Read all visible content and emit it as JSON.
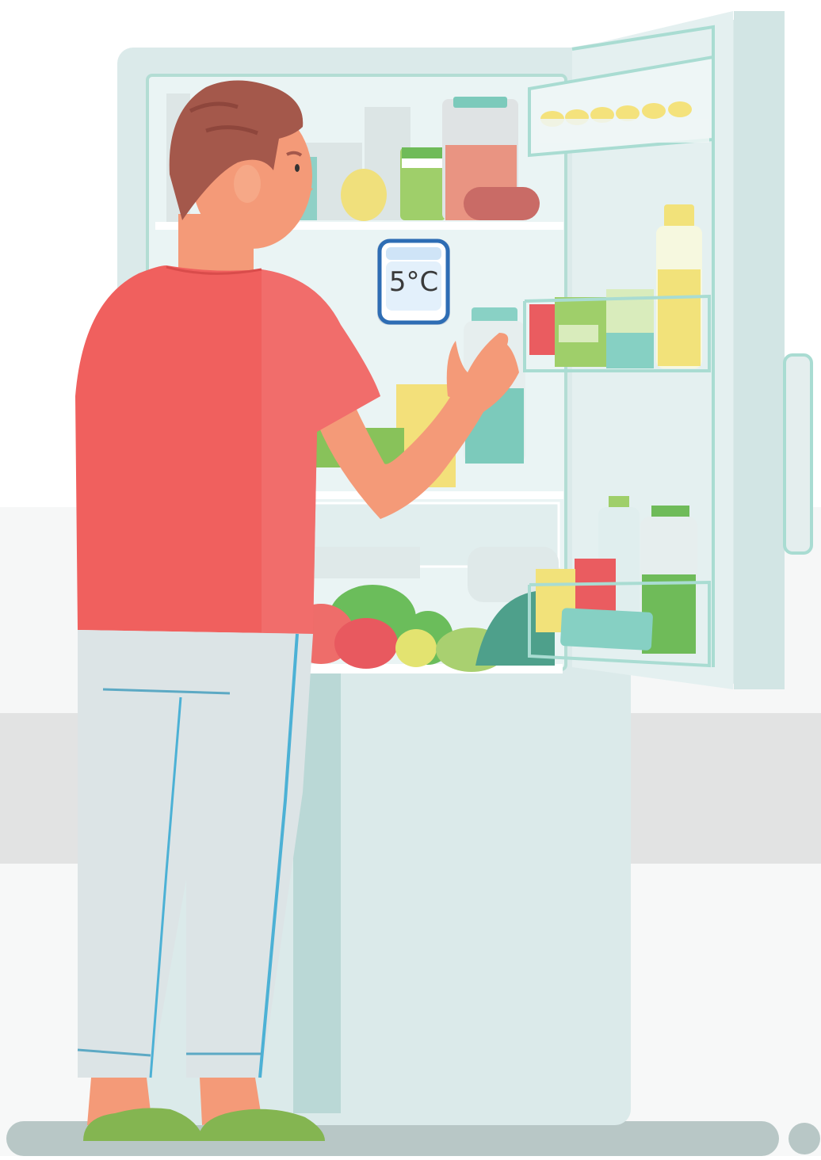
{
  "thermostat": {
    "temperature": "5°C"
  },
  "colors": {
    "wall": "#ffffff",
    "counter": "#dcdcdc",
    "fridge_body": "#dbeaea",
    "fridge_inside": "#eaf4f4",
    "fridge_trim": "#a9dcd2",
    "shirt": "#f0605e",
    "skin": "#f49a78",
    "hair": "#a4584b",
    "pants": "#dce4e6",
    "slippers": "#84b551",
    "display_border": "#2e6db4"
  }
}
